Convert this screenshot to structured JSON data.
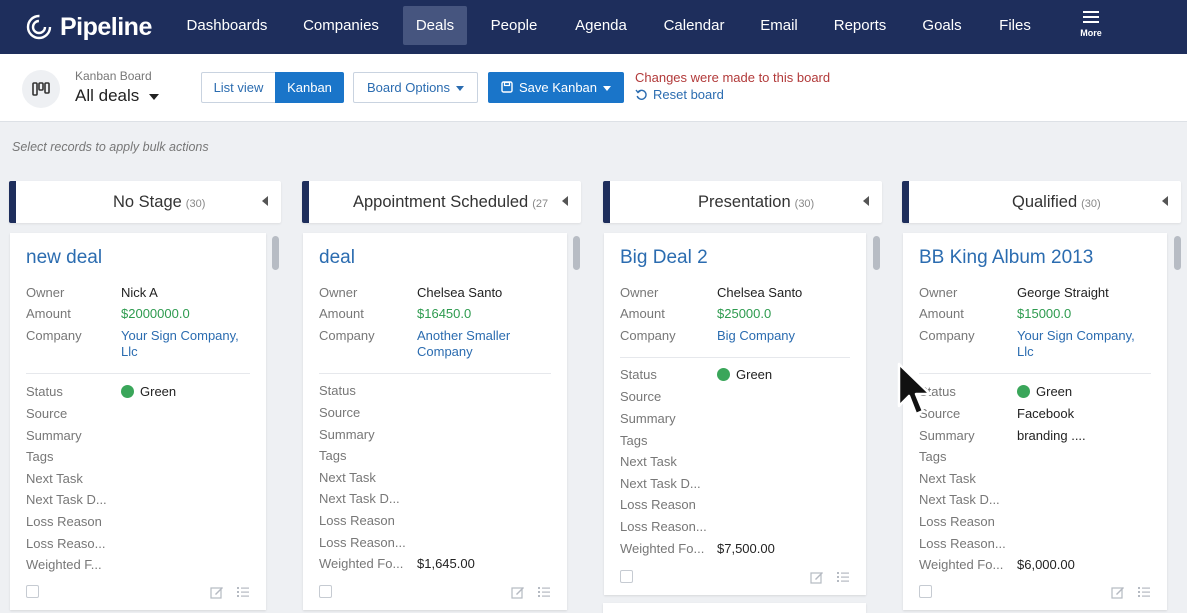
{
  "nav": {
    "logo": "Pipeline",
    "items": [
      "Dashboards",
      "Companies",
      "Deals",
      "People",
      "Agenda",
      "Calendar",
      "Email",
      "Reports",
      "Goals",
      "Files"
    ],
    "active": "Deals",
    "more": "More"
  },
  "toolbar": {
    "board_small": "Kanban Board",
    "board_name": "All deals",
    "list_view": "List view",
    "kanban": "Kanban",
    "board_options": "Board Options",
    "save_kanban": "Save Kanban",
    "changes_message": "Changes were made to this board",
    "reset_board": "Reset board"
  },
  "bulk_actions_hint": "Select records to apply bulk actions",
  "columns": [
    {
      "title": "No Stage",
      "count": "(30)"
    },
    {
      "title": "Appointment Scheduled",
      "count": "(27"
    },
    {
      "title": "Presentation",
      "count": "(30)"
    },
    {
      "title": "Qualified",
      "count": "(30)"
    }
  ],
  "field_labels": {
    "owner": "Owner",
    "amount": "Amount",
    "company": "Company",
    "status": "Status",
    "source": "Source",
    "summary": "Summary",
    "tags": "Tags",
    "next_task": "Next Task",
    "next_task_date": "Next Task D...",
    "loss_reason": "Loss Reason",
    "loss_reason_2": "Loss Reaso...",
    "loss_reason_2b": "Loss Reason...",
    "weighted_a": "Weighted F...",
    "weighted_b": "Weighted Fo..."
  },
  "cards": [
    {
      "title": "new deal",
      "owner": "Nick A",
      "amount": "$2000000.0",
      "company_line1": "Your Sign Company,",
      "company_line2": "Llc",
      "status": "Green",
      "source": "",
      "summary": "",
      "weighted": ""
    },
    {
      "title": "deal",
      "owner": "Chelsea Santo",
      "amount": "$16450.0",
      "company_line1": "Another Smaller",
      "company_line2": "Company",
      "status": "",
      "source": "",
      "summary": "",
      "weighted": "$1,645.00"
    },
    {
      "title": "Big Deal 2",
      "owner": "Chelsea Santo",
      "amount": "$25000.0",
      "company_line1": "Big Company",
      "company_line2": "",
      "status": "Green",
      "source": "",
      "summary": "",
      "weighted": "$7,500.00"
    },
    {
      "title": "BB King Album 2013",
      "owner": "George Straight",
      "amount": "$15000.0",
      "company_line1": "Your Sign Company,",
      "company_line2": "Llc",
      "status": "Green",
      "source": "Facebook",
      "summary": "branding ....",
      "weighted": "$6,000.00"
    }
  ],
  "colors": {
    "nav_bg": "#1e2e5c",
    "accent": "#1a75c9",
    "link": "#2b6cb0",
    "amount_green": "#2e9b4f",
    "status_green": "#3aa65a",
    "warning_red": "#b23a3a"
  }
}
